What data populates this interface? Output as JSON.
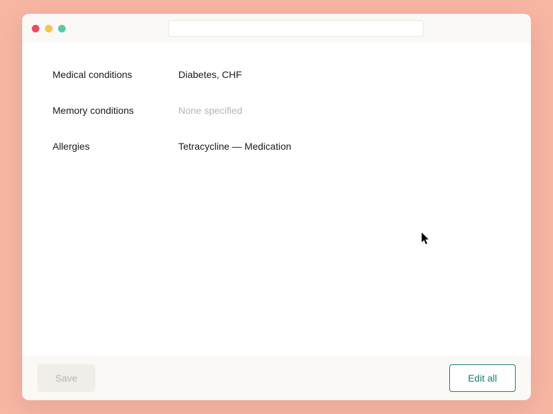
{
  "titlebar": {
    "search_placeholder": ""
  },
  "content": {
    "rows": [
      {
        "label": "Medical conditions",
        "value": "Diabetes, CHF",
        "muted": false
      },
      {
        "label": "Memory conditions",
        "value": "None specified",
        "muted": true
      },
      {
        "label": "Allergies",
        "value": "Tetracycline — Medication",
        "muted": false
      }
    ]
  },
  "footer": {
    "save_label": "Save",
    "edit_label": "Edit all"
  }
}
